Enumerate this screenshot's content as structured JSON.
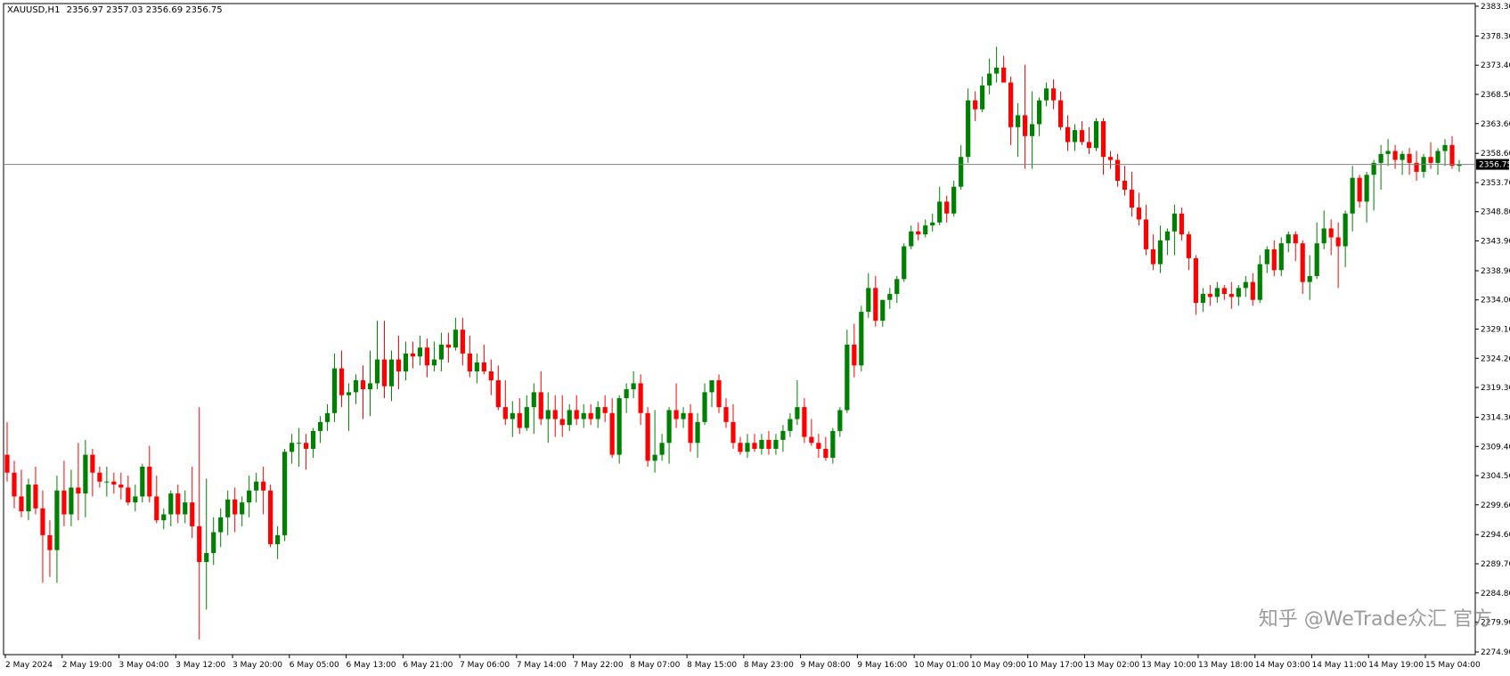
{
  "header": {
    "symbol": "XAUUSD,H1",
    "ohlc": "2356.97 2357.03 2356.69 2356.75"
  },
  "watermark": {
    "text": "知乎 @WeTrade众汇 官方"
  },
  "colors": {
    "bull": "#008000",
    "bear": "#ff0000",
    "axis": "#000000",
    "grid": "#c0c0c0",
    "price_line": "#808080"
  },
  "chart_data": {
    "type": "candlestick",
    "ylim": [
      2274.9,
      2383.3
    ],
    "y_ticks": [
      "2383.30",
      "2378.30",
      "2373.40",
      "2368.50",
      "2363.60",
      "2358.60",
      "2353.70",
      "2348.80",
      "2343.90",
      "2338.90",
      "2334.00",
      "2329.10",
      "2324.20",
      "2319.30",
      "2314.30",
      "2309.40",
      "2304.50",
      "2299.60",
      "2294.60",
      "2289.70",
      "2284.80",
      "2279.90",
      "2274.90"
    ],
    "x_ticks": [
      "2 May 2024",
      "2 May 19:00",
      "3 May 04:00",
      "3 May 12:00",
      "3 May 20:00",
      "6 May 05:00",
      "6 May 13:00",
      "6 May 21:00",
      "7 May 06:00",
      "7 May 14:00",
      "7 May 22:00",
      "8 May 07:00",
      "8 May 15:00",
      "8 May 23:00",
      "9 May 08:00",
      "9 May 16:00",
      "10 May 01:00",
      "10 May 09:00",
      "10 May 17:00",
      "13 May 02:00",
      "13 May 10:00",
      "13 May 18:00",
      "14 May 03:00",
      "14 May 11:00",
      "14 May 19:00",
      "15 May 04:00"
    ],
    "current_price": "2356.75",
    "candles": [
      [
        2308.0,
        2313.5,
        2303.5,
        2305.0
      ],
      [
        2305.0,
        2307.0,
        2299.0,
        2301.0
      ],
      [
        2301.0,
        2305.5,
        2297.5,
        2298.5
      ],
      [
        2298.5,
        2304.0,
        2297.0,
        2303.0
      ],
      [
        2303.0,
        2306.0,
        2298.0,
        2299.0
      ],
      [
        2299.0,
        2302.0,
        2286.5,
        2294.5
      ],
      [
        2294.5,
        2297.0,
        2287.5,
        2292.0
      ],
      [
        2292.0,
        2304.5,
        2286.5,
        2302.0
      ],
      [
        2302.0,
        2307.0,
        2296.0,
        2298.0
      ],
      [
        2298.0,
        2305.5,
        2296.0,
        2302.5
      ],
      [
        2302.5,
        2310.0,
        2297.0,
        2301.5
      ],
      [
        2301.5,
        2310.5,
        2297.5,
        2308.0
      ],
      [
        2308.0,
        2309.0,
        2301.0,
        2305.0
      ],
      [
        2305.0,
        2306.0,
        2302.5,
        2303.5
      ],
      [
        2303.5,
        2306.0,
        2301.0,
        2303.5
      ],
      [
        2303.5,
        2305.0,
        2301.5,
        2303.0
      ],
      [
        2303.0,
        2305.0,
        2300.5,
        2302.5
      ],
      [
        2302.5,
        2304.5,
        2299.5,
        2300.0
      ],
      [
        2300.0,
        2303.0,
        2298.5,
        2301.0
      ],
      [
        2301.0,
        2306.5,
        2300.0,
        2306.0
      ],
      [
        2306.0,
        2309.5,
        2300.0,
        2301.0
      ],
      [
        2301.0,
        2304.5,
        2296.5,
        2297.0
      ],
      [
        2297.0,
        2299.0,
        2295.5,
        2298.0
      ],
      [
        2298.0,
        2302.0,
        2296.0,
        2301.5
      ],
      [
        2301.5,
        2303.0,
        2296.5,
        2298.0
      ],
      [
        2298.0,
        2302.0,
        2296.5,
        2300.0
      ],
      [
        2300.0,
        2306.0,
        2294.0,
        2296.0
      ],
      [
        2296.0,
        2316.0,
        2277.0,
        2290.0
      ],
      [
        2290.0,
        2304.0,
        2282.0,
        2291.5
      ],
      [
        2291.5,
        2297.5,
        2289.5,
        2295.0
      ],
      [
        2295.0,
        2299.0,
        2292.5,
        2297.5
      ],
      [
        2297.5,
        2302.0,
        2294.5,
        2300.5
      ],
      [
        2300.5,
        2302.5,
        2295.0,
        2298.0
      ],
      [
        2298.0,
        2301.0,
        2296.0,
        2300.0
      ],
      [
        2300.0,
        2304.5,
        2297.5,
        2302.0
      ],
      [
        2302.0,
        2305.0,
        2300.0,
        2303.5
      ],
      [
        2303.5,
        2306.0,
        2298.0,
        2302.0
      ],
      [
        2302.0,
        2303.0,
        2292.5,
        2293.0
      ],
      [
        2293.0,
        2296.0,
        2290.5,
        2294.5
      ],
      [
        2294.5,
        2309.0,
        2293.5,
        2308.5
      ],
      [
        2308.5,
        2311.5,
        2306.5,
        2310.0
      ],
      [
        2310.0,
        2312.5,
        2306.0,
        2310.0
      ],
      [
        2310.0,
        2311.5,
        2305.5,
        2309.0
      ],
      [
        2309.0,
        2312.5,
        2307.5,
        2312.0
      ],
      [
        2312.0,
        2314.5,
        2310.0,
        2313.5
      ],
      [
        2313.5,
        2316.5,
        2312.0,
        2315.0
      ],
      [
        2315.0,
        2325.0,
        2313.5,
        2322.5
      ],
      [
        2322.5,
        2325.5,
        2316.0,
        2318.0
      ],
      [
        2318.0,
        2320.0,
        2312.0,
        2318.5
      ],
      [
        2318.5,
        2321.5,
        2316.5,
        2320.5
      ],
      [
        2320.5,
        2323.0,
        2314.0,
        2319.0
      ],
      [
        2319.0,
        2325.5,
        2314.5,
        2320.0
      ],
      [
        2320.0,
        2330.5,
        2319.0,
        2324.0
      ],
      [
        2324.0,
        2330.5,
        2317.5,
        2319.5
      ],
      [
        2319.5,
        2325.5,
        2317.0,
        2324.0
      ],
      [
        2324.0,
        2328.0,
        2319.0,
        2322.0
      ],
      [
        2322.0,
        2327.0,
        2320.5,
        2325.0
      ],
      [
        2325.0,
        2327.0,
        2322.5,
        2324.5
      ],
      [
        2324.5,
        2328.0,
        2323.0,
        2326.0
      ],
      [
        2326.0,
        2327.5,
        2321.0,
        2323.0
      ],
      [
        2323.0,
        2327.0,
        2322.0,
        2324.0
      ],
      [
        2324.0,
        2328.5,
        2322.0,
        2326.5
      ],
      [
        2326.5,
        2328.5,
        2323.5,
        2326.0
      ],
      [
        2326.0,
        2331.0,
        2325.5,
        2329.0
      ],
      [
        2329.0,
        2331.0,
        2323.0,
        2325.0
      ],
      [
        2325.0,
        2328.0,
        2321.0,
        2322.0
      ],
      [
        2322.0,
        2325.0,
        2320.0,
        2323.5
      ],
      [
        2323.5,
        2326.5,
        2321.5,
        2322.0
      ],
      [
        2322.0,
        2324.0,
        2318.0,
        2320.5
      ],
      [
        2320.5,
        2323.0,
        2315.5,
        2316.0
      ],
      [
        2316.0,
        2320.5,
        2313.0,
        2314.0
      ],
      [
        2314.0,
        2317.0,
        2311.0,
        2315.0
      ],
      [
        2315.0,
        2317.5,
        2311.5,
        2312.5
      ],
      [
        2312.5,
        2318.0,
        2312.0,
        2316.0
      ],
      [
        2316.0,
        2320.0,
        2311.5,
        2318.5
      ],
      [
        2318.5,
        2322.0,
        2313.0,
        2314.0
      ],
      [
        2314.0,
        2318.5,
        2310.0,
        2315.5
      ],
      [
        2315.5,
        2318.0,
        2311.0,
        2314.0
      ],
      [
        2314.0,
        2318.0,
        2311.0,
        2313.0
      ],
      [
        2313.0,
        2316.5,
        2312.0,
        2315.5
      ],
      [
        2315.5,
        2318.0,
        2313.0,
        2314.0
      ],
      [
        2314.0,
        2316.5,
        2312.5,
        2315.0
      ],
      [
        2315.0,
        2316.5,
        2313.0,
        2314.0
      ],
      [
        2314.0,
        2317.0,
        2312.5,
        2316.0
      ],
      [
        2316.0,
        2318.0,
        2313.5,
        2315.0
      ],
      [
        2315.0,
        2317.5,
        2307.5,
        2308.0
      ],
      [
        2308.0,
        2318.0,
        2306.5,
        2317.5
      ],
      [
        2317.5,
        2320.0,
        2315.0,
        2319.0
      ],
      [
        2319.0,
        2322.0,
        2317.5,
        2320.0
      ],
      [
        2320.0,
        2321.5,
        2313.0,
        2315.0
      ],
      [
        2315.0,
        2316.0,
        2306.0,
        2307.0
      ],
      [
        2307.0,
        2315.5,
        2305.0,
        2308.0
      ],
      [
        2308.0,
        2311.5,
        2307.0,
        2310.0
      ],
      [
        2310.0,
        2316.0,
        2306.5,
        2315.5
      ],
      [
        2315.5,
        2320.0,
        2312.5,
        2314.0
      ],
      [
        2314.0,
        2316.0,
        2312.5,
        2315.0
      ],
      [
        2315.0,
        2316.5,
        2308.5,
        2310.0
      ],
      [
        2310.0,
        2315.0,
        2307.5,
        2313.5
      ],
      [
        2313.5,
        2320.0,
        2313.0,
        2318.5
      ],
      [
        2318.5,
        2320.5,
        2316.0,
        2320.5
      ],
      [
        2320.5,
        2321.5,
        2315.0,
        2316.0
      ],
      [
        2316.0,
        2317.5,
        2312.5,
        2313.5
      ],
      [
        2313.5,
        2316.5,
        2309.0,
        2310.0
      ],
      [
        2310.0,
        2311.0,
        2308.0,
        2308.5
      ],
      [
        2308.5,
        2311.5,
        2307.5,
        2310.0
      ],
      [
        2310.0,
        2311.5,
        2308.5,
        2309.0
      ],
      [
        2309.0,
        2311.5,
        2308.0,
        2310.5
      ],
      [
        2310.5,
        2312.0,
        2308.0,
        2309.0
      ],
      [
        2309.0,
        2311.5,
        2308.0,
        2310.5
      ],
      [
        2310.5,
        2313.0,
        2308.5,
        2312.0
      ],
      [
        2312.0,
        2315.0,
        2311.0,
        2314.0
      ],
      [
        2314.0,
        2320.5,
        2313.0,
        2316.0
      ],
      [
        2316.0,
        2317.5,
        2310.0,
        2311.0
      ],
      [
        2311.0,
        2314.0,
        2309.5,
        2310.0
      ],
      [
        2310.0,
        2311.5,
        2307.5,
        2309.0
      ],
      [
        2309.0,
        2311.0,
        2307.0,
        2307.5
      ],
      [
        2307.5,
        2312.5,
        2306.5,
        2312.0
      ],
      [
        2312.0,
        2316.0,
        2311.0,
        2315.5
      ],
      [
        2315.5,
        2329.0,
        2315.0,
        2326.5
      ],
      [
        2326.5,
        2330.0,
        2321.0,
        2323.0
      ],
      [
        2323.0,
        2333.0,
        2322.0,
        2332.0
      ],
      [
        2332.0,
        2338.5,
        2331.0,
        2336.0
      ],
      [
        2336.0,
        2338.0,
        2329.5,
        2330.5
      ],
      [
        2330.5,
        2334.0,
        2329.5,
        2334.0
      ],
      [
        2334.0,
        2336.0,
        2332.5,
        2335.0
      ],
      [
        2335.0,
        2338.0,
        2333.5,
        2337.5
      ],
      [
        2337.5,
        2343.5,
        2337.0,
        2343.0
      ],
      [
        2343.0,
        2346.5,
        2342.5,
        2345.5
      ],
      [
        2345.5,
        2347.0,
        2344.0,
        2345.0
      ],
      [
        2345.0,
        2347.5,
        2344.5,
        2346.5
      ],
      [
        2346.5,
        2348.5,
        2345.5,
        2347.0
      ],
      [
        2347.0,
        2353.0,
        2346.5,
        2350.5
      ],
      [
        2350.5,
        2351.5,
        2347.0,
        2348.5
      ],
      [
        2348.5,
        2354.0,
        2348.0,
        2353.0
      ],
      [
        2353.0,
        2360.0,
        2352.5,
        2358.0
      ],
      [
        2358.0,
        2369.5,
        2357.0,
        2367.5
      ],
      [
        2367.5,
        2369.0,
        2364.0,
        2366.0
      ],
      [
        2366.0,
        2371.5,
        2365.5,
        2370.0
      ],
      [
        2370.0,
        2374.5,
        2368.5,
        2372.0
      ],
      [
        2372.0,
        2376.5,
        2370.5,
        2373.0
      ],
      [
        2373.0,
        2375.0,
        2370.5,
        2370.5
      ],
      [
        2370.5,
        2371.5,
        2360.0,
        2363.0
      ],
      [
        2363.0,
        2367.0,
        2358.0,
        2365.0
      ],
      [
        2365.0,
        2373.5,
        2356.0,
        2361.5
      ],
      [
        2361.5,
        2369.0,
        2356.0,
        2363.5
      ],
      [
        2363.5,
        2368.0,
        2361.5,
        2367.5
      ],
      [
        2367.5,
        2370.5,
        2366.5,
        2369.5
      ],
      [
        2369.5,
        2371.0,
        2366.0,
        2367.5
      ],
      [
        2367.5,
        2369.0,
        2362.5,
        2363.0
      ],
      [
        2363.0,
        2365.0,
        2359.0,
        2360.5
      ],
      [
        2360.5,
        2363.5,
        2359.0,
        2362.5
      ],
      [
        2362.5,
        2364.0,
        2360.0,
        2360.5
      ],
      [
        2360.5,
        2363.0,
        2358.5,
        2359.5
      ],
      [
        2359.5,
        2364.5,
        2359.0,
        2364.0
      ],
      [
        2364.0,
        2364.5,
        2355.0,
        2358.0
      ],
      [
        2358.0,
        2359.0,
        2356.0,
        2357.5
      ],
      [
        2357.5,
        2358.5,
        2353.0,
        2354.0
      ],
      [
        2354.0,
        2356.5,
        2351.5,
        2352.5
      ],
      [
        2352.5,
        2355.5,
        2348.0,
        2349.5
      ],
      [
        2349.5,
        2352.0,
        2346.5,
        2347.5
      ],
      [
        2347.5,
        2350.0,
        2341.5,
        2342.5
      ],
      [
        2342.5,
        2345.0,
        2339.0,
        2340.0
      ],
      [
        2340.0,
        2346.5,
        2338.5,
        2344.0
      ],
      [
        2344.0,
        2346.0,
        2341.5,
        2345.5
      ],
      [
        2345.5,
        2350.0,
        2341.5,
        2348.5
      ],
      [
        2348.5,
        2349.5,
        2344.0,
        2345.0
      ],
      [
        2345.0,
        2345.5,
        2339.0,
        2341.0
      ],
      [
        2341.0,
        2341.5,
        2331.5,
        2333.5
      ],
      [
        2333.5,
        2336.0,
        2332.0,
        2335.0
      ],
      [
        2335.0,
        2336.5,
        2333.0,
        2334.5
      ],
      [
        2334.5,
        2337.0,
        2333.5,
        2336.0
      ],
      [
        2336.0,
        2336.5,
        2334.0,
        2335.0
      ],
      [
        2335.0,
        2337.0,
        2332.5,
        2334.5
      ],
      [
        2334.5,
        2336.5,
        2333.0,
        2336.0
      ],
      [
        2336.0,
        2338.0,
        2334.5,
        2337.0
      ],
      [
        2337.0,
        2338.5,
        2333.0,
        2334.0
      ],
      [
        2334.0,
        2341.5,
        2333.5,
        2340.0
      ],
      [
        2340.0,
        2343.0,
        2338.5,
        2342.5
      ],
      [
        2342.5,
        2344.0,
        2338.0,
        2339.0
      ],
      [
        2339.0,
        2344.5,
        2338.0,
        2343.5
      ],
      [
        2343.5,
        2345.5,
        2342.0,
        2345.0
      ],
      [
        2345.0,
        2345.5,
        2340.5,
        2343.5
      ],
      [
        2343.5,
        2344.0,
        2335.0,
        2337.0
      ],
      [
        2337.0,
        2341.5,
        2334.0,
        2338.0
      ],
      [
        2338.0,
        2347.0,
        2337.5,
        2343.5
      ],
      [
        2343.5,
        2349.0,
        2342.5,
        2346.0
      ],
      [
        2346.0,
        2347.5,
        2341.5,
        2344.5
      ],
      [
        2344.5,
        2347.0,
        2336.0,
        2343.0
      ],
      [
        2343.0,
        2349.0,
        2339.5,
        2348.5
      ],
      [
        2348.5,
        2356.5,
        2345.5,
        2354.5
      ],
      [
        2354.5,
        2355.0,
        2349.5,
        2350.5
      ],
      [
        2350.5,
        2355.5,
        2347.0,
        2355.0
      ],
      [
        2355.0,
        2357.5,
        2349.0,
        2357.0
      ],
      [
        2357.0,
        2360.0,
        2352.5,
        2358.5
      ],
      [
        2358.5,
        2361.0,
        2356.5,
        2359.0
      ],
      [
        2359.0,
        2360.0,
        2356.0,
        2357.5
      ],
      [
        2357.5,
        2359.0,
        2355.0,
        2358.5
      ],
      [
        2358.5,
        2359.5,
        2355.0,
        2357.0
      ],
      [
        2357.0,
        2359.0,
        2354.0,
        2355.5
      ],
      [
        2355.5,
        2358.5,
        2354.5,
        2358.0
      ],
      [
        2358.0,
        2360.5,
        2356.0,
        2357.0
      ],
      [
        2357.0,
        2359.5,
        2355.0,
        2359.0
      ],
      [
        2359.0,
        2361.0,
        2356.5,
        2360.0
      ],
      [
        2360.0,
        2361.5,
        2356.0,
        2356.5
      ],
      [
        2356.5,
        2357.5,
        2355.5,
        2356.75
      ]
    ]
  }
}
